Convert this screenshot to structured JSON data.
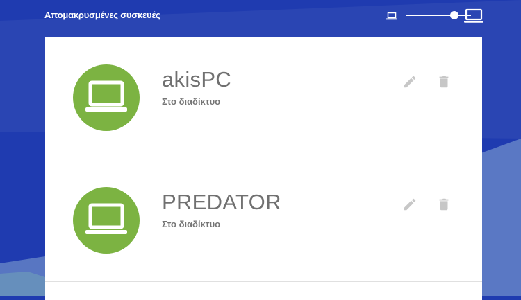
{
  "header": {
    "title": "Απομακρυσμένες συσκευές"
  },
  "colors": {
    "background": "#1f3bb0",
    "avatar": "#7cb342",
    "name_text": "#707070",
    "icon_muted": "#c7c7c7"
  },
  "devices": [
    {
      "name": "akisPC",
      "status": "Στο διαδίκτυο",
      "icon": "laptop-icon"
    },
    {
      "name": "PREDATOR",
      "status": "Στο διαδίκτυο",
      "icon": "laptop-icon"
    }
  ]
}
